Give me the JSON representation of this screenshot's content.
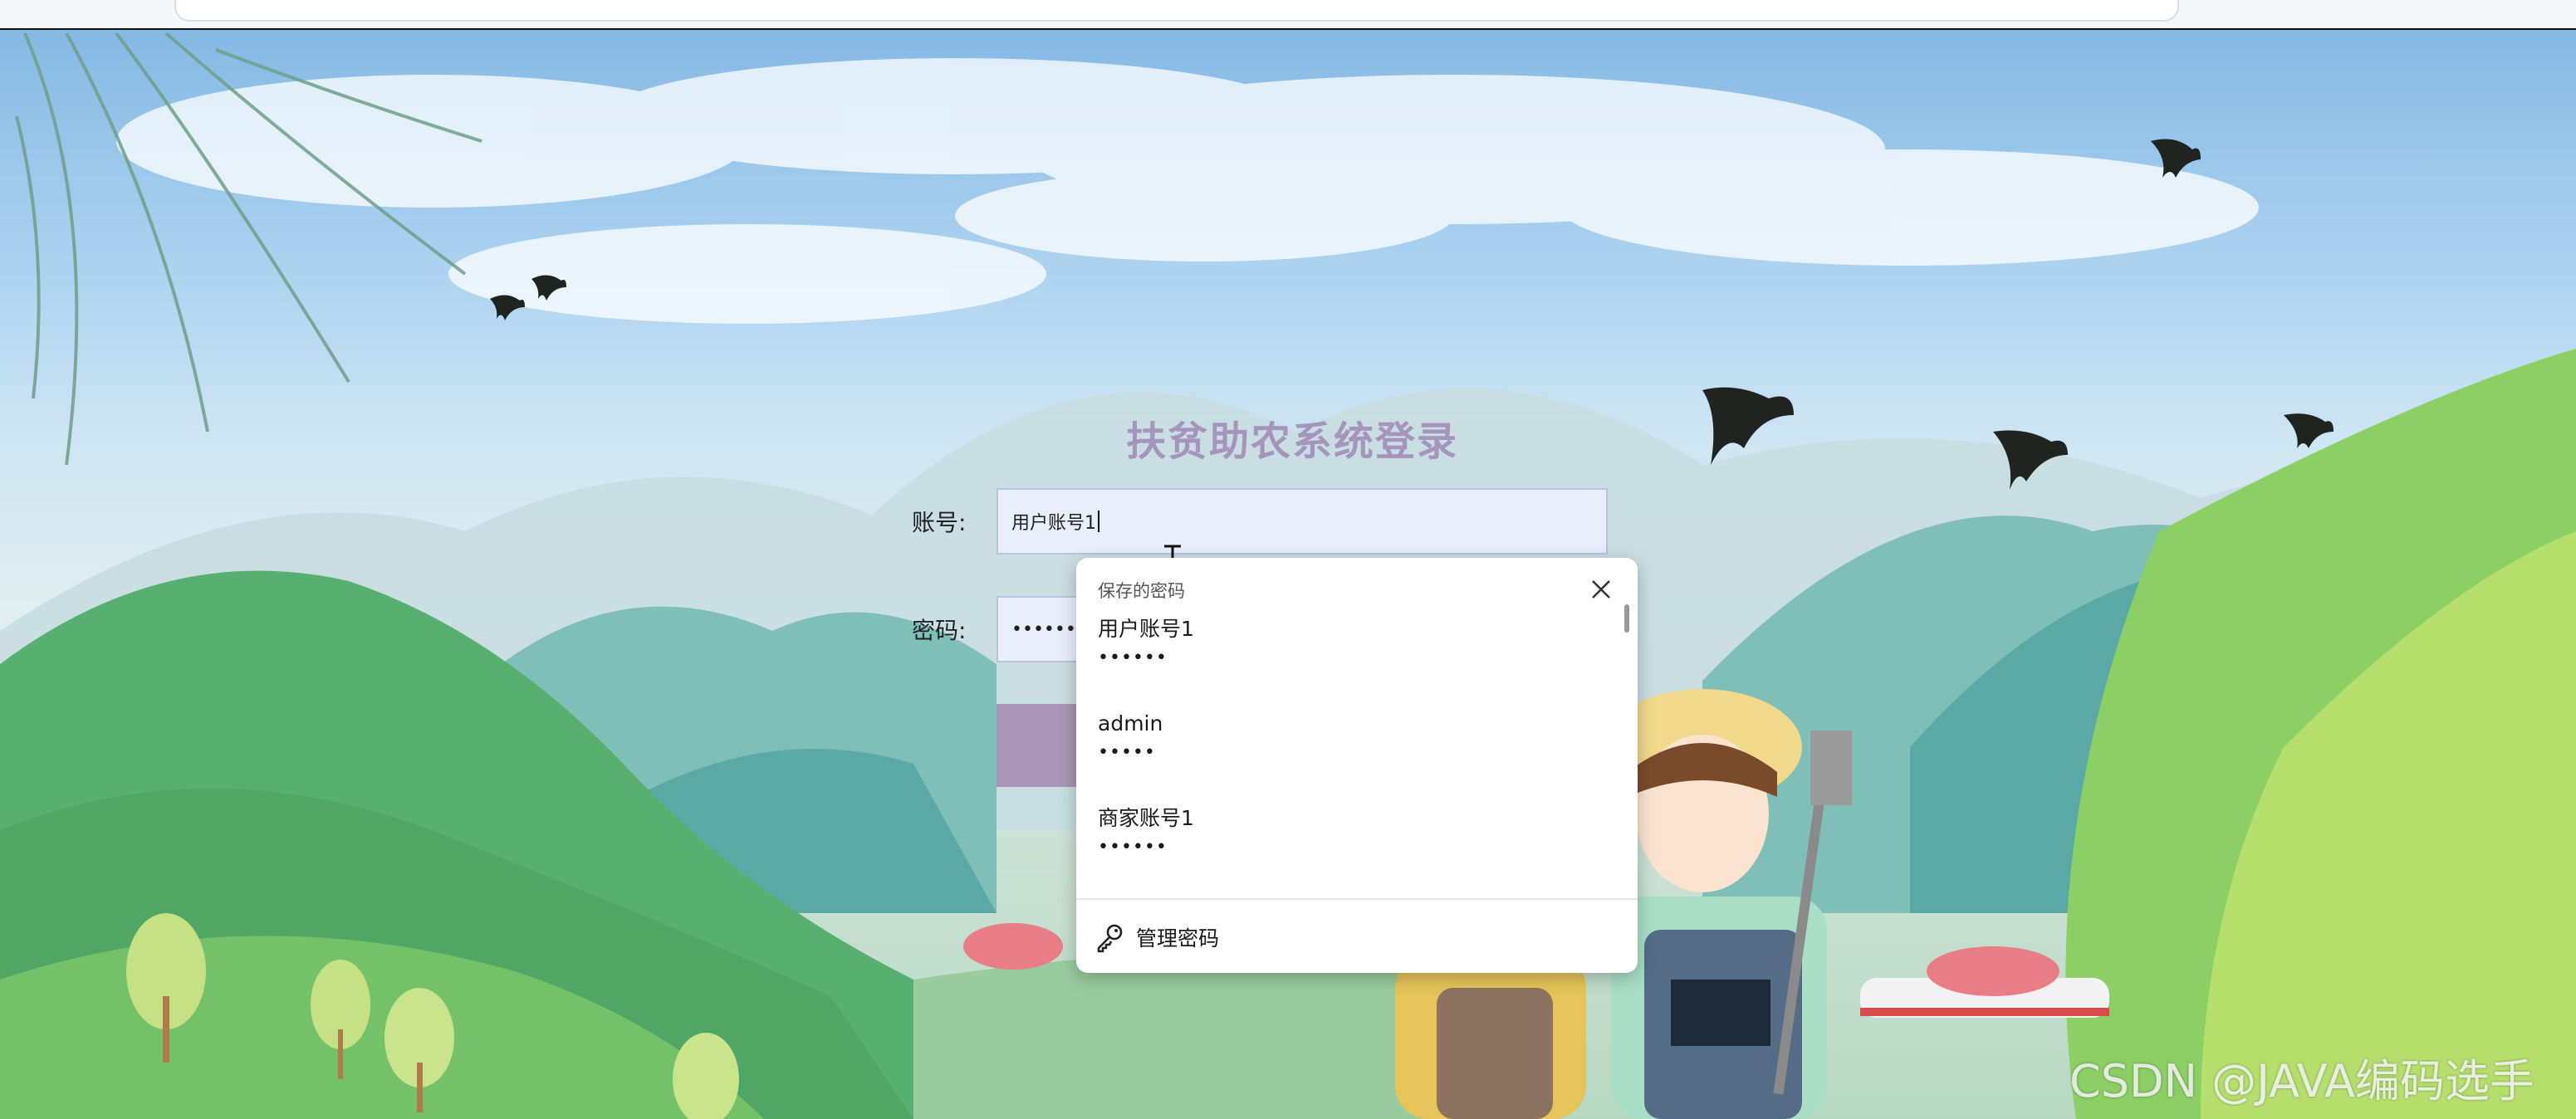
{
  "login": {
    "title": "扶贫助农系统登录",
    "account_label": "账号:",
    "account_value": "用户账号1",
    "password_label": "密码:",
    "password_mask": "••••••"
  },
  "saved_passwords": {
    "header": "保存的密码",
    "entries": [
      {
        "username": "用户账号1",
        "password": "••••••"
      },
      {
        "username": "admin",
        "password": "•••••"
      },
      {
        "username": "商家账号1",
        "password": "••••••"
      }
    ],
    "manage_label": "管理密码"
  },
  "watermark": "CSDN @JAVA编码选手",
  "icons": {
    "close": "close-icon",
    "key": "key-icon",
    "cursor": "text-cursor-icon"
  },
  "colors": {
    "title": "#a594bb",
    "field_bg": "#e8eefb",
    "button": "#a996b6"
  }
}
